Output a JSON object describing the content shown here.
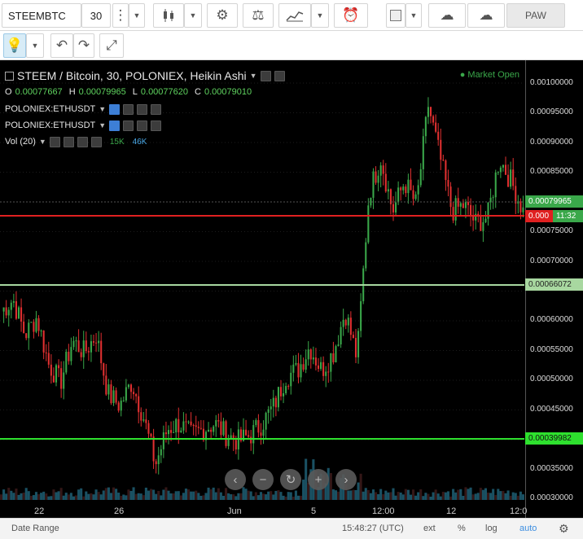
{
  "toolbar": {
    "symbol": "STEEMBTC",
    "interval": "30",
    "paw_label": "PAW"
  },
  "chart": {
    "title": "STEEM / Bitcoin, 30, POLONIEX, Heikin Ashi",
    "ohlc": {
      "o_label": "O",
      "o": "0.00077667",
      "h_label": "H",
      "h": "0.00079965",
      "l_label": "L",
      "l": "0.00077620",
      "c_label": "C",
      "c": "0.00079010"
    },
    "indicators": [
      "POLONIEX:ETHUSDT",
      "POLONIEX:ETHUSDT"
    ],
    "volume": {
      "name": "Vol (20)",
      "a": "15K",
      "b": "46K"
    },
    "market_status": "Market Open",
    "price_ticks": [
      "0.00100000",
      "0.00095000",
      "0.00090000",
      "0.00085000",
      "0.00075000",
      "0.00070000",
      "0.00060000",
      "0.00055000",
      "0.00050000",
      "0.00045000",
      "0.00035000",
      "0.00030000"
    ],
    "price_tags": {
      "last": "0.00079965",
      "current": "0.000",
      "countdown": "11:32",
      "green_level": "0.00066072",
      "bright_level": "0.00039982"
    },
    "time_labels": [
      "22",
      "26",
      "Jun",
      "5",
      "12:00",
      "12",
      "12:0"
    ]
  },
  "footer": {
    "date_range": "Date Range",
    "time": "15:48:27 (UTC)",
    "ext": "ext",
    "pct": "%",
    "log": "log",
    "auto": "auto"
  },
  "colors": {
    "up": "#3aa84a",
    "down": "#e03030",
    "red_line": "#e02020",
    "green_line": "#a8d8a0",
    "bright_line": "#2ee02e"
  },
  "chart_data": {
    "type": "candlestick",
    "title": "STEEM / Bitcoin, 30, POLONIEX, Heikin Ashi",
    "x": [
      "22",
      "26",
      "Jun",
      "5",
      "12:00",
      "12",
      "12:0"
    ],
    "y_ticks": [
      0.0003,
      0.00035,
      0.0004,
      0.00045,
      0.0005,
      0.00055,
      0.0006,
      0.0007,
      0.00075,
      0.00085,
      0.0009,
      0.00095,
      0.001
    ],
    "close_path": [
      0.00062,
      0.00064,
      0.00058,
      0.00061,
      0.00053,
      0.0005,
      0.00057,
      0.00055,
      0.00058,
      0.00048,
      0.00046,
      0.0005,
      0.00044,
      0.00036,
      0.00042,
      0.00043,
      0.00041,
      0.00042,
      0.00043,
      0.00041,
      0.0004,
      0.00041,
      0.00043,
      0.00046,
      0.00051,
      0.00052,
      0.00056,
      0.00052,
      0.00055,
      0.00062,
      0.00054,
      0.00082,
      0.00088,
      0.00079,
      0.00084,
      0.0008,
      0.00097,
      0.00088,
      0.00079,
      0.0008,
      0.00077,
      0.00078,
      0.00088,
      0.00084,
      0.00079
    ],
    "horizontal_lines": [
      0.00066072,
      0.00039982
    ],
    "ylim": [
      0.0003,
      0.00101
    ]
  }
}
